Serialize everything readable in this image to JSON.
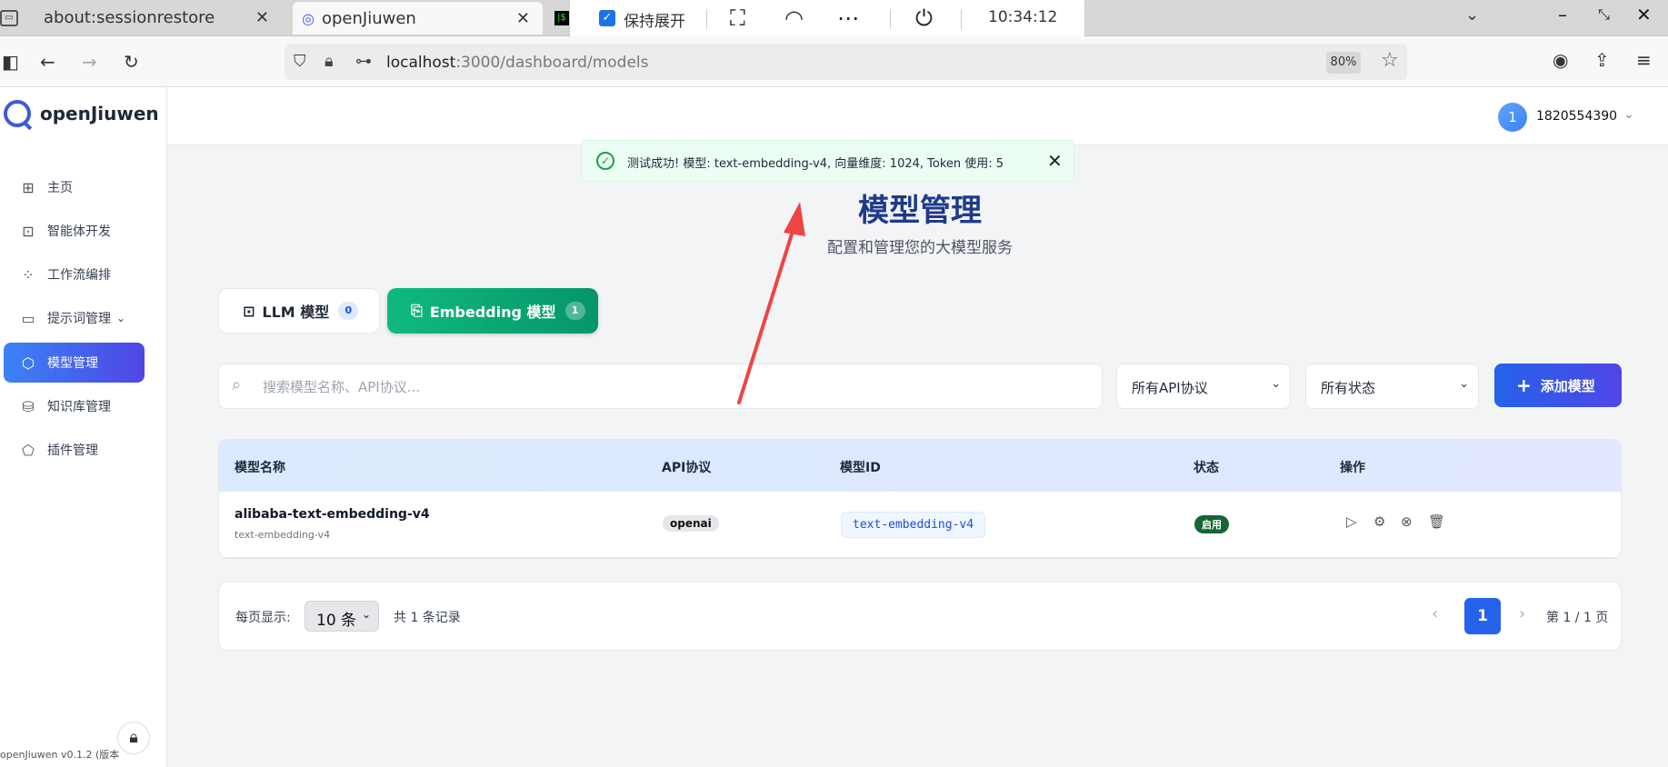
{
  "browser": {
    "tabs": [
      {
        "label": "about:sessionrestore"
      },
      {
        "label": "openJiuwen"
      }
    ],
    "url_host": "localhost",
    "url_path": ":3000/dashboard/models",
    "zoom": "80%"
  },
  "system_bar": {
    "keep_expanded": "保持展开",
    "time": "10:34:12"
  },
  "sidebar": {
    "brand": "openJiuwen",
    "items": [
      {
        "label": "主页",
        "icon": "grid-icon"
      },
      {
        "label": "智能体开发",
        "icon": "robot-icon"
      },
      {
        "label": "工作流编排",
        "icon": "workflow-icon"
      },
      {
        "label": "提示词管理",
        "icon": "chat-icon"
      },
      {
        "label": "模型管理",
        "icon": "model-icon",
        "active": true
      },
      {
        "label": "知识库管理",
        "icon": "database-icon"
      },
      {
        "label": "插件管理",
        "icon": "plugin-icon"
      }
    ],
    "version": "openJiuwen v0.1.2 (版本"
  },
  "header": {
    "avatar_letter": "1",
    "username": "1820554390"
  },
  "toast": {
    "message": "测试成功! 模型: text-embedding-v4, 向量维度: 1024, Token 使用: 5"
  },
  "page": {
    "title": "模型管理",
    "subtitle": "配置和管理您的大模型服务"
  },
  "model_tabs": [
    {
      "label": "LLM 模型",
      "count": "0",
      "active": false
    },
    {
      "label": "Embedding 模型",
      "count": "1",
      "active": true
    }
  ],
  "filters": {
    "search_placeholder": "搜索模型名称、API协议...",
    "api_select": "所有API协议",
    "status_select": "所有状态",
    "add_button": "添加模型"
  },
  "table": {
    "columns": [
      "模型名称",
      "API协议",
      "模型ID",
      "状态",
      "操作"
    ],
    "rows": [
      {
        "name": "alibaba-text-embedding-v4",
        "sub": "text-embedding-v4",
        "api": "openai",
        "model_id": "text-embedding-v4",
        "status": "启用"
      }
    ]
  },
  "pagination": {
    "per_page_label": "每页显示:",
    "per_page_value": "10 条",
    "total": "共 1 条记录",
    "current": "1",
    "info": "第 1 / 1 页"
  },
  "colors": {
    "primary": "#2563eb",
    "success": "#10b981",
    "annotation": "#ef4444"
  }
}
